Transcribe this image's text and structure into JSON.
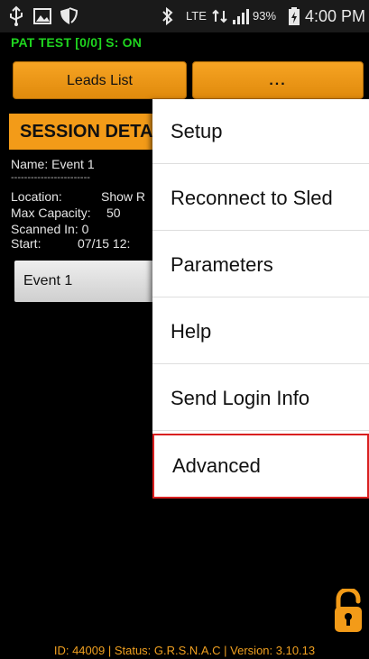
{
  "status_bar": {
    "network_type": "LTE",
    "battery_percent": "93%",
    "time": "4:00 PM",
    "icons": [
      "usb-icon",
      "gallery-icon",
      "shield-icon",
      "bluetooth-icon",
      "lte-data-icon",
      "signal-icon",
      "battery-charging-icon"
    ]
  },
  "debug_line": "PAT TEST [0/0] S: ON",
  "toolbar": {
    "leads_list_label": "Leads List",
    "more_label": "..."
  },
  "session": {
    "header": "SESSION DETA",
    "name_line": "Name: Event 1",
    "separator": "------------------------",
    "location_label": "Location:",
    "location_value": "Show R",
    "max_capacity_label": "Max Capacity:",
    "max_capacity_value": "50",
    "scanned_in_label": "Scanned In:",
    "scanned_in_value": "0",
    "start_label": "Start:",
    "start_value": "07/15 12:",
    "event_button": "Event 1"
  },
  "menu": {
    "items": [
      {
        "label": "Setup"
      },
      {
        "label": "Reconnect to Sled"
      },
      {
        "label": "Parameters"
      },
      {
        "label": "Help"
      },
      {
        "label": "Send Login Info"
      },
      {
        "label": "Advanced",
        "highlighted": true
      }
    ]
  },
  "footer": "ID: 44009 | Status: G.R.S.N.A.C | Version: 3.10.13",
  "colors": {
    "accent_orange": "#f39b18",
    "debug_green": "#1fd51f",
    "highlight_red": "#d92020",
    "footer_orange": "#f0a020"
  }
}
